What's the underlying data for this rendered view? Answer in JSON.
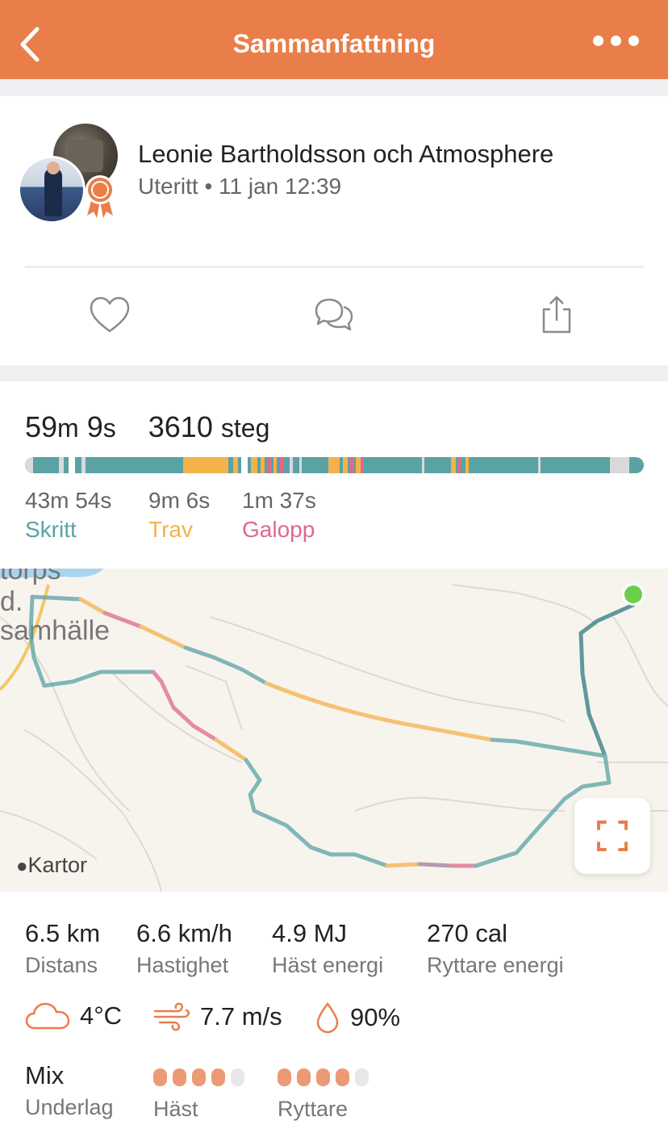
{
  "nav": {
    "title": "Sammanfattning"
  },
  "header": {
    "name": "Leonie Bartholdsson och Atmosphere",
    "subtitle": "Uteritt • 11 jan 12:39"
  },
  "summary": {
    "duration_min": "59",
    "duration_min_unit": "m",
    "duration_sec": "9",
    "duration_sec_unit": "s",
    "steps": "3610",
    "steps_unit": "steg"
  },
  "gaits": [
    {
      "time": "43m 54s",
      "label": "Skritt",
      "color": "#5aa2a4"
    },
    {
      "time": "9m 6s",
      "label": "Trav",
      "color": "#f4b24a"
    },
    {
      "time": "1m 37s",
      "label": "Galopp",
      "color": "#dc6a8a"
    }
  ],
  "map": {
    "labels": [
      "torps",
      "d.",
      "samhälle"
    ],
    "attribution": "Kartor"
  },
  "metrics": [
    {
      "value": "6.5 km",
      "label": "Distans"
    },
    {
      "value": "6.6 km/h",
      "label": "Hastighet"
    },
    {
      "value": "4.9 MJ",
      "label": "Häst energi"
    },
    {
      "value": "270 cal",
      "label": "Ryttare energi"
    }
  ],
  "weather": {
    "temperature": "4°C",
    "wind": "7.7 m/s",
    "humidity": "90%"
  },
  "ratings": {
    "surface_value": "Mix",
    "surface_label": "Underlag",
    "horse_label": "Häst",
    "horse_score": 4,
    "rider_label": "Ryttare",
    "rider_score": 4,
    "max_score": 5
  },
  "colors": {
    "accent": "#e97e4a",
    "walk": "#5aa2a4",
    "trot": "#f4b24a",
    "canter": "#dc6a8a"
  }
}
